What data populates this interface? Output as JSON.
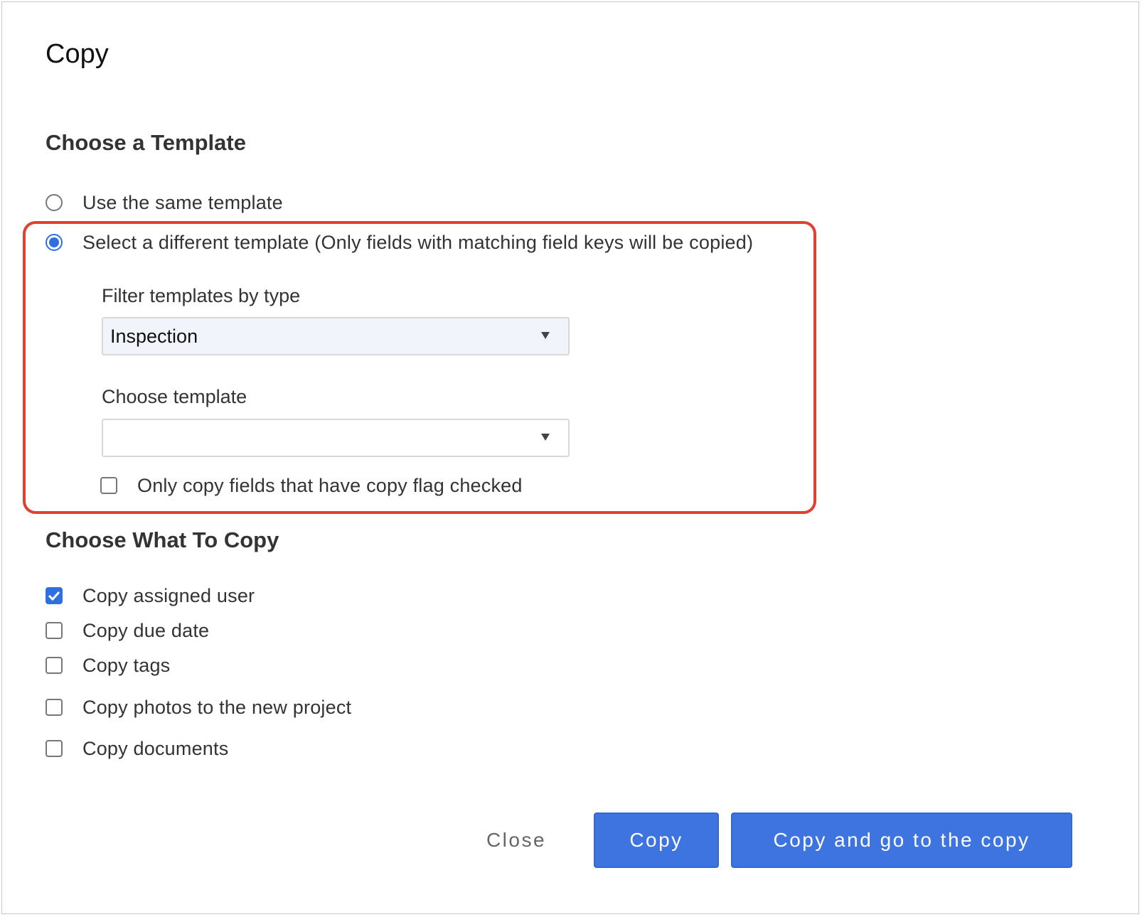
{
  "dialog": {
    "title": "Copy"
  },
  "template_section": {
    "heading": "Choose a Template",
    "options": [
      {
        "label": "Use the same template",
        "checked": false
      },
      {
        "label": "Select a different template (Only fields with matching field keys will be copied)",
        "checked": true
      }
    ],
    "filter": {
      "label": "Filter templates by type",
      "value": "Inspection"
    },
    "choose": {
      "label": "Choose template",
      "value": ""
    },
    "copy_flag": {
      "label": "Only copy fields that have copy flag checked",
      "checked": false
    }
  },
  "copy_section": {
    "heading": "Choose What To Copy",
    "items": [
      {
        "label": "Copy assigned user",
        "checked": true
      },
      {
        "label": "Copy due date",
        "checked": false
      },
      {
        "label": "Copy tags",
        "checked": false
      },
      {
        "label": "Copy photos to the new project",
        "checked": false
      },
      {
        "label": "Copy documents",
        "checked": false
      }
    ]
  },
  "footer": {
    "close_label": "Close",
    "copy_label": "Copy",
    "copy_go_label": "Copy and go to the copy"
  },
  "colors": {
    "accent": "#3d74e0",
    "highlight": "#e0402f"
  }
}
